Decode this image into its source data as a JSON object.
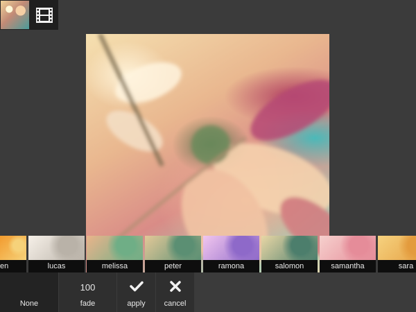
{
  "toolbar": {
    "thumbnail_icon": "photo-thumbnail",
    "video_icon": "film-icon"
  },
  "filters": [
    {
      "label": "en",
      "colors": [
        "#f29b2e",
        "#f6d27a"
      ]
    },
    {
      "label": "lucas",
      "colors": [
        "#f6f0e8",
        "#b9b2a8"
      ]
    },
    {
      "label": "melissa",
      "colors": [
        "#e9b48b",
        "#6fae86"
      ]
    },
    {
      "label": "peter",
      "colors": [
        "#e2c898",
        "#5b8f73"
      ]
    },
    {
      "label": "ramona",
      "colors": [
        "#f1c6ee",
        "#8e69c9"
      ]
    },
    {
      "label": "salomon",
      "colors": [
        "#e8d6a5",
        "#4c7e6c"
      ]
    },
    {
      "label": "samantha",
      "colors": [
        "#f6d0cd",
        "#e58c99"
      ]
    },
    {
      "label": "sara",
      "colors": [
        "#f6d27f",
        "#e39b3d"
      ]
    }
  ],
  "selected_filter": "melissa",
  "bottom": {
    "none_label": "None",
    "fade_value": "100",
    "fade_label": "fade",
    "apply_label": "apply",
    "cancel_label": "cancel"
  }
}
